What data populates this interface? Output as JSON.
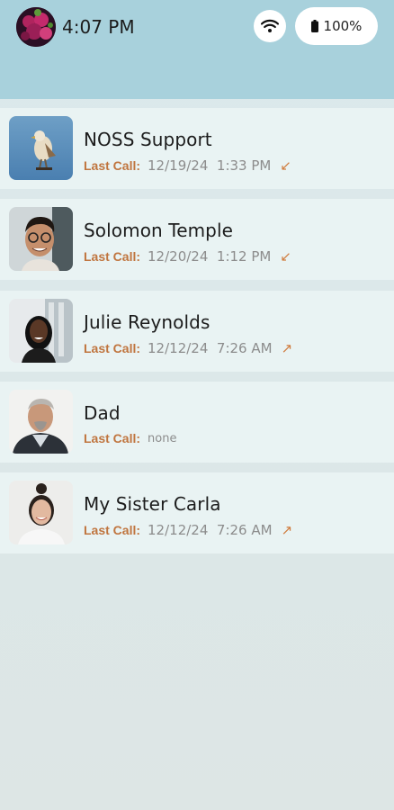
{
  "status_bar": {
    "time": "4:07 PM",
    "battery": "100%",
    "icons": [
      "profile-avatar",
      "wifi-icon",
      "battery-icon"
    ]
  },
  "label_last_call": "Last Call:",
  "contacts": [
    {
      "name": "NOSS Support",
      "last_call": "12/19/24  1:33 PM",
      "direction": "incoming",
      "arrow": "↙"
    },
    {
      "name": "Solomon Temple",
      "last_call": "12/20/24  1:12 PM",
      "direction": "incoming",
      "arrow": "↙"
    },
    {
      "name": "Julie Reynolds",
      "last_call": "12/12/24  7:26 AM",
      "direction": "outgoing",
      "arrow": "↗"
    },
    {
      "name": "Dad",
      "last_call": "none",
      "direction": "",
      "arrow": ""
    },
    {
      "name": "My Sister Carla",
      "last_call": "12/12/24  7:26 AM",
      "direction": "outgoing",
      "arrow": "↗"
    }
  ],
  "colors": {
    "header": "#a8d1dc",
    "row_bg": "#e9f3f3",
    "label_accent": "#c0753f",
    "muted_text": "#8c8c8c"
  }
}
